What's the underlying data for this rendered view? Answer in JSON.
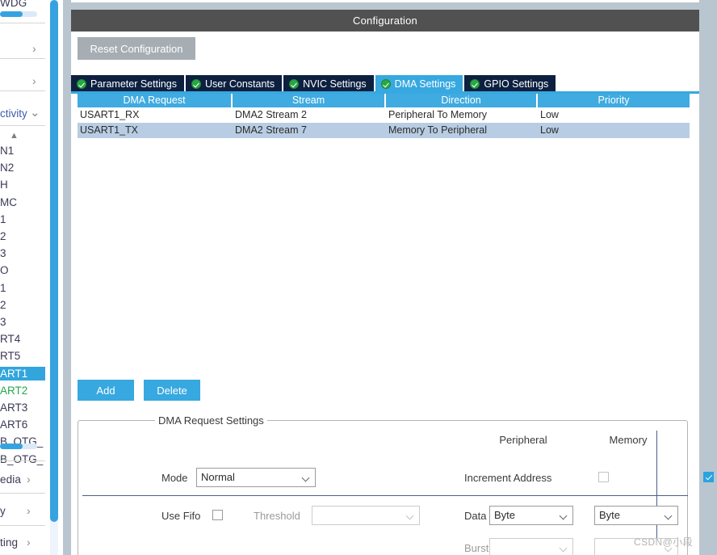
{
  "window": {
    "config_title": "Configuration",
    "reset_button": "Reset Configuration"
  },
  "sidebar": {
    "top_truncated_item": "WDG",
    "sections": [
      {
        "label": "",
        "chevron": "›"
      },
      {
        "label": "",
        "chevron": "›"
      }
    ],
    "connectivity_label": "ctivity",
    "connectivity_chevron": "⌄",
    "spinner_icon": "scroll-up-icon",
    "peripherals": [
      {
        "label": "N1",
        "state": "normal"
      },
      {
        "label": "N2",
        "state": "normal"
      },
      {
        "label": "H",
        "state": "normal"
      },
      {
        "label": "MC",
        "state": "normal"
      },
      {
        "label": "1",
        "state": "normal"
      },
      {
        "label": "2",
        "state": "normal"
      },
      {
        "label": "3",
        "state": "normal"
      },
      {
        "label": "O",
        "state": "normal"
      },
      {
        "label": "1",
        "state": "normal"
      },
      {
        "label": "2",
        "state": "normal"
      },
      {
        "label": "3",
        "state": "normal"
      },
      {
        "label": "RT4",
        "state": "normal"
      },
      {
        "label": "RT5",
        "state": "normal"
      },
      {
        "label": "ART1",
        "state": "selected"
      },
      {
        "label": "ART2",
        "state": "enabled"
      },
      {
        "label": "ART3",
        "state": "normal"
      },
      {
        "label": "ART6",
        "state": "normal"
      },
      {
        "label": "B_OTG_",
        "state": "normal"
      },
      {
        "label": "B_OTG_",
        "state": "normal"
      }
    ],
    "bottom_sections": [
      {
        "label": "edia",
        "chevron": "›"
      },
      {
        "label": "y",
        "chevron": "›"
      },
      {
        "label": "ting",
        "chevron": "›"
      }
    ]
  },
  "tabs": [
    {
      "label": "Parameter Settings",
      "active": false,
      "icon": "check-circle-icon"
    },
    {
      "label": "User Constants",
      "active": false,
      "icon": "check-circle-icon"
    },
    {
      "label": "NVIC Settings",
      "active": false,
      "icon": "check-circle-icon"
    },
    {
      "label": "DMA Settings",
      "active": true,
      "icon": "check-circle-icon"
    },
    {
      "label": "GPIO Settings",
      "active": false,
      "icon": "check-circle-icon"
    }
  ],
  "table": {
    "columns": [
      "DMA Request",
      "Stream",
      "Direction",
      "Priority"
    ],
    "rows": [
      {
        "cells": [
          "USART1_RX",
          "DMA2 Stream 2",
          "Peripheral To Memory",
          "Low"
        ],
        "selected": false
      },
      {
        "cells": [
          "USART1_TX",
          "DMA2 Stream 7",
          "Memory To Peripheral",
          "Low"
        ],
        "selected": true
      }
    ]
  },
  "actions": {
    "add": "Add",
    "delete": "Delete"
  },
  "request_settings": {
    "legend": "DMA Request Settings",
    "col_peripheral": "Peripheral",
    "col_memory": "Memory",
    "mode_label": "Mode",
    "mode_value": "Normal",
    "increment_address_label": "Increment Address",
    "increment_peripheral_checked": false,
    "increment_memory_checked": true,
    "use_fifo_label": "Use Fifo",
    "use_fifo_checked": false,
    "threshold_label": "Threshold",
    "threshold_value": "",
    "data_width_label": "Data Width",
    "data_width_peripheral": "Byte",
    "data_width_memory": "Byte",
    "burst_size_label": "Burst Size",
    "burst_size_peripheral": "",
    "burst_size_memory": ""
  },
  "watermark": "CSDN@小段",
  "colors": {
    "accent": "#37a8e0",
    "tab_inactive": "#0d2040",
    "titlebar": "#515151",
    "row_selected": "#b8cde3",
    "enabled_green": "#23a84e"
  }
}
